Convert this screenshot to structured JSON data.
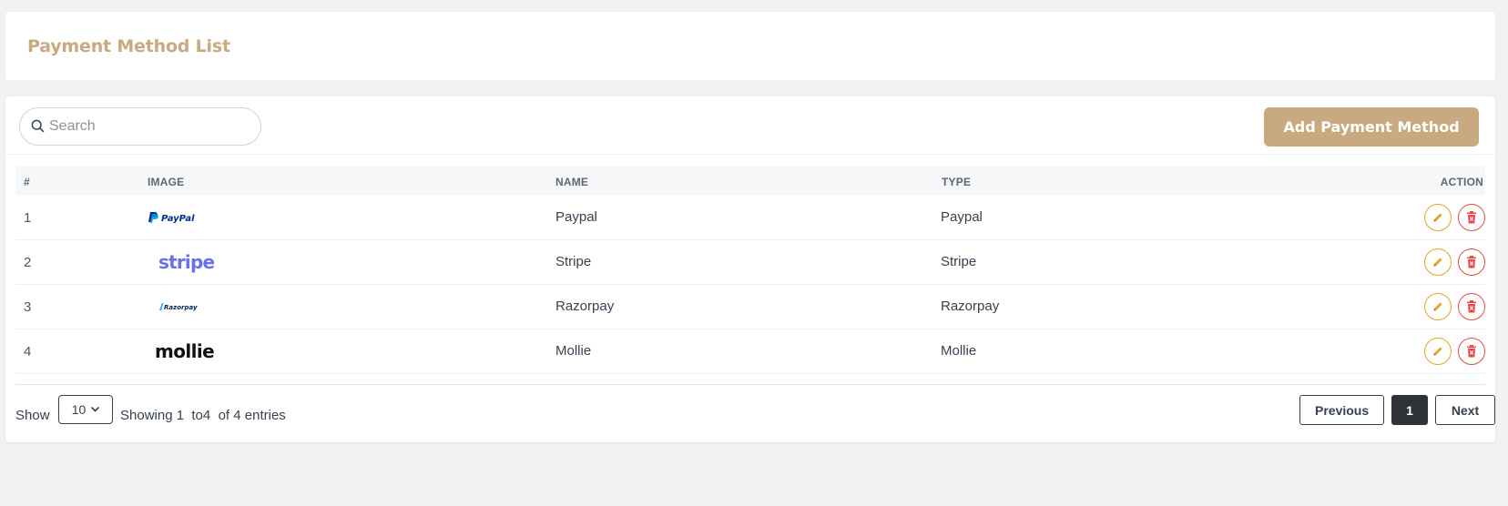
{
  "page": {
    "title": "Payment Method List"
  },
  "toolbar": {
    "search_placeholder": "Search",
    "add_label": "Add Payment Method"
  },
  "table": {
    "columns": {
      "num": "#",
      "image": "IMAGE",
      "name": "NAME",
      "type": "TYPE",
      "action": "ACTION"
    },
    "rows": [
      {
        "num": "1",
        "logo": "PayPal",
        "name": "Paypal",
        "type": "Paypal"
      },
      {
        "num": "2",
        "logo": "stripe",
        "name": "Stripe",
        "type": "Stripe"
      },
      {
        "num": "3",
        "logo": "Razorpay",
        "name": "Razorpay",
        "type": "Razorpay"
      },
      {
        "num": "4",
        "logo": "mollie",
        "name": "Mollie",
        "type": "Mollie"
      }
    ]
  },
  "footer": {
    "show_label": "Show",
    "page_size": "10",
    "entries_text": "Showing 1  to4  of 4 entries",
    "prev_label": "Previous",
    "current_page": "1",
    "next_label": "Next"
  },
  "colors": {
    "accent": "#c9a97f",
    "edit": "#e0a526",
    "delete": "#e5484d",
    "active_page": "#2f3338"
  },
  "icons": {
    "search": "search-icon",
    "edit": "pencil-icon",
    "delete": "trash-icon",
    "dropdown": "chevron-down-icon"
  }
}
